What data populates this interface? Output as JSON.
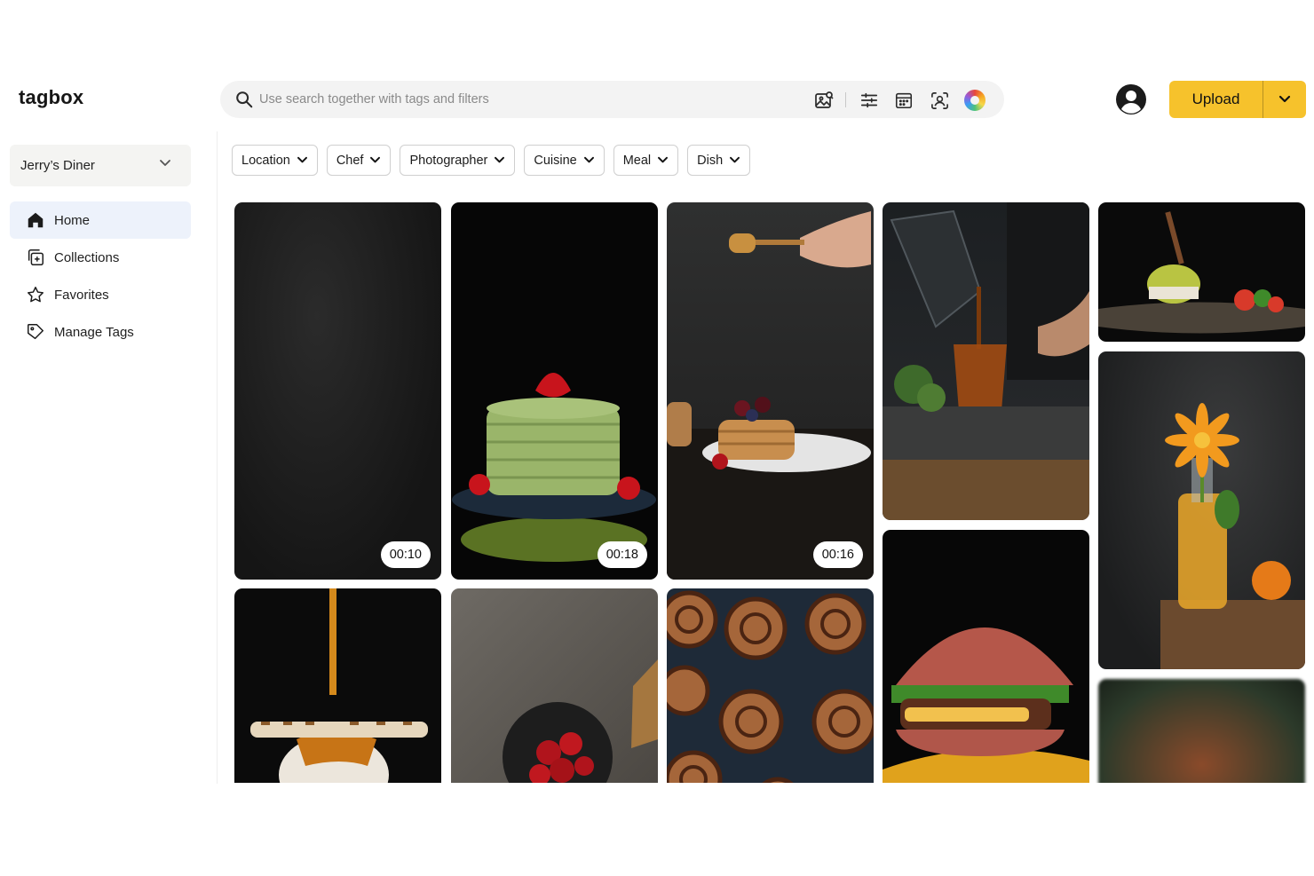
{
  "app": {
    "logo": "tagbox"
  },
  "search": {
    "placeholder": "Use search together with tags and filters"
  },
  "header": {
    "upload_label": "Upload"
  },
  "sidebar": {
    "workspace": "Jerry’s Diner",
    "items": [
      {
        "label": "Home",
        "icon": "home-icon",
        "active": true
      },
      {
        "label": "Collections",
        "icon": "collections-icon",
        "active": false
      },
      {
        "label": "Favorites",
        "icon": "star-icon",
        "active": false
      },
      {
        "label": "Manage Tags",
        "icon": "tag-icon",
        "active": false
      }
    ]
  },
  "filters": [
    "Location",
    "Chef",
    "Photographer",
    "Cuisine",
    "Meal",
    "Dish"
  ],
  "gallery": {
    "durations": [
      "00:10",
      "00:18",
      "00:16"
    ]
  },
  "colors": {
    "accent": "#f6c22c",
    "active_nav_bg": "#edf2fb"
  }
}
